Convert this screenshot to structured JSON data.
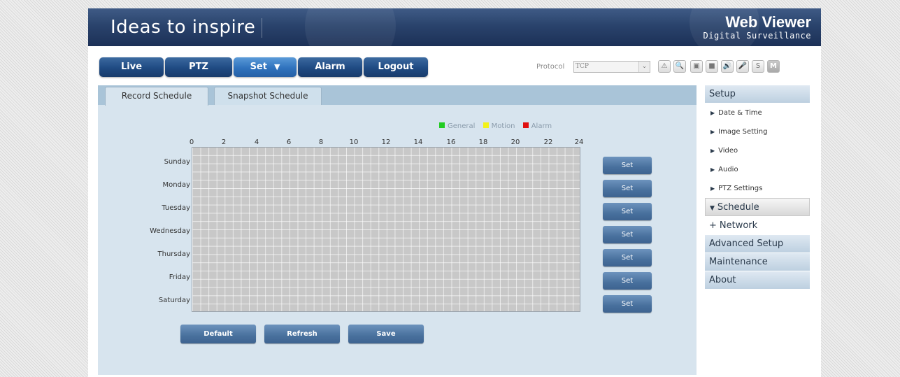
{
  "header": {
    "slogan": "Ideas to inspire",
    "brand_title": "Web Viewer",
    "brand_subtitle": "Digital Surveillance"
  },
  "nav": {
    "live": "Live",
    "ptz": "PTZ",
    "set": "Set",
    "alarm": "Alarm",
    "logout": "Logout"
  },
  "protocol": {
    "label": "Protocol",
    "value": "TCP"
  },
  "toolbar_icons": [
    {
      "name": "alert-icon",
      "glyph": "⚠"
    },
    {
      "name": "zoom-icon",
      "glyph": "🔍"
    },
    {
      "name": "snapshot-icon",
      "glyph": "▣"
    },
    {
      "name": "record-icon",
      "glyph": "■"
    },
    {
      "name": "speaker-icon",
      "glyph": "🔊"
    },
    {
      "name": "microphone-icon",
      "glyph": "🎤"
    },
    {
      "name": "s-icon",
      "glyph": "S"
    },
    {
      "name": "m-icon",
      "glyph": "M"
    }
  ],
  "tabs": {
    "record": "Record Schedule",
    "snapshot": "Snapshot Schedule"
  },
  "legend": {
    "general": "General",
    "motion": "Motion",
    "alarm": "Alarm",
    "general_color": "#22cc22",
    "motion_color": "#f2f21a",
    "alarm_color": "#e01010"
  },
  "schedule": {
    "hours": [
      "0",
      "2",
      "4",
      "6",
      "8",
      "10",
      "12",
      "14",
      "16",
      "18",
      "20",
      "22",
      "24"
    ],
    "days": [
      "Sunday",
      "Monday",
      "Tuesday",
      "Wednesday",
      "Thursday",
      "Friday",
      "Saturday"
    ],
    "set_label": "Set"
  },
  "actions": {
    "default": "Default",
    "refresh": "Refresh",
    "save": "Save"
  },
  "sidebar": {
    "setup": "Setup",
    "items": [
      "Date & Time",
      "Image Setting",
      "Video",
      "Audio",
      "PTZ Settings"
    ],
    "schedule": "Schedule",
    "network": "Network",
    "advanced": "Advanced Setup",
    "maintenance": "Maintenance",
    "about": "About"
  }
}
